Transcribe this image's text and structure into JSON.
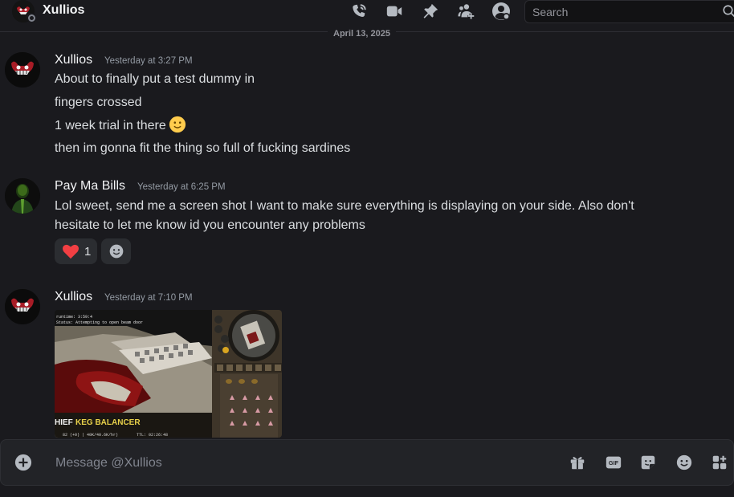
{
  "header": {
    "title": "Xullios",
    "search_placeholder": "Search",
    "icons": [
      "voice-call-icon",
      "video-call-icon",
      "pin-icon",
      "add-friends-icon",
      "user-profile-icon",
      "search-icon"
    ]
  },
  "date_divider": "April 13, 2025",
  "messages": [
    {
      "author": "Xullios",
      "timestamp": "Yesterday at 3:27 PM",
      "lines": [
        "About to finally put a test dummy in",
        "fingers crossed",
        "1 week trial in there",
        "then im gonna fit the thing so full of fucking sardines"
      ]
    },
    {
      "author": "Pay Ma Bills",
      "timestamp": "Yesterday at 6:25 PM",
      "lines": [
        "Lol sweet, send me a screen shot I want to make sure everything is displaying on your side. Also don't",
        "hesitate to let me know id you encounter any problems"
      ],
      "reaction": {
        "emoji": "heart",
        "count": "1"
      }
    },
    {
      "author": "Xullios",
      "timestamp": "Yesterday at 7:10 PM",
      "attachment": {
        "overlay_line1": "runtime: 3:59:4",
        "overlay_line2": "Status: Attempting to open beam door",
        "banner_prefix": "HIEF",
        "banner_text": "KEG BALANCER",
        "footer_left": "82 (+0) | 40K/40.6K/hr)",
        "footer_right": "TTL: 02:26:48"
      }
    }
  ],
  "composer": {
    "placeholder": "Message @Xullios",
    "icons": [
      "add-attachment-icon",
      "gift-icon",
      "gif-icon",
      "sticker-icon",
      "emoji-icon",
      "apps-icon"
    ]
  },
  "colors": {
    "background": "#1a1a1e",
    "text": "#dbdee1",
    "muted": "#949ba4",
    "accent_heart": "#f23f43"
  }
}
